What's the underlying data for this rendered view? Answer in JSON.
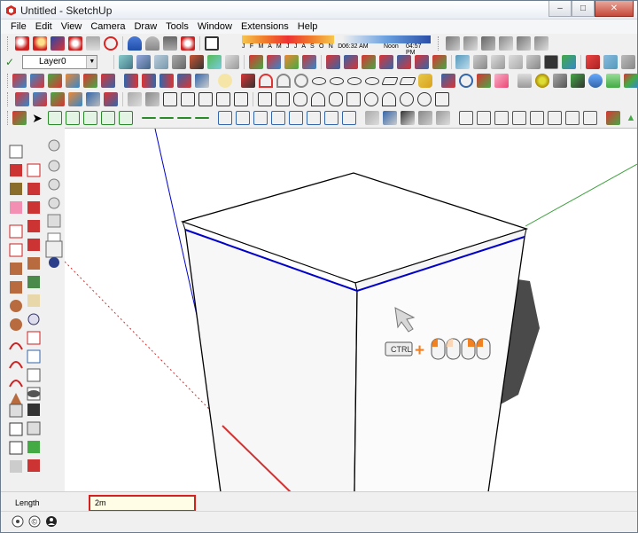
{
  "window": {
    "title": "Untitled - SketchUp"
  },
  "menu": [
    "File",
    "Edit",
    "View",
    "Camera",
    "Draw",
    "Tools",
    "Window",
    "Extensions",
    "Help"
  ],
  "layer": {
    "current": "Layer0"
  },
  "shadows": {
    "months": "J F M A M J J A S O N D",
    "time_start": "06:32 AM",
    "noon": "Noon",
    "time_end": "04:57 PM"
  },
  "hint": {
    "ctrl_label": "CTRL",
    "plus": "+"
  },
  "vcb": {
    "label": "Length",
    "value": "2m"
  },
  "colors": {
    "blue_axis": "#0000c8",
    "green_axis": "#3ca03c",
    "red_axis": "#d23232",
    "highlight": "#d42020",
    "title_bar": "#e9eef5"
  }
}
